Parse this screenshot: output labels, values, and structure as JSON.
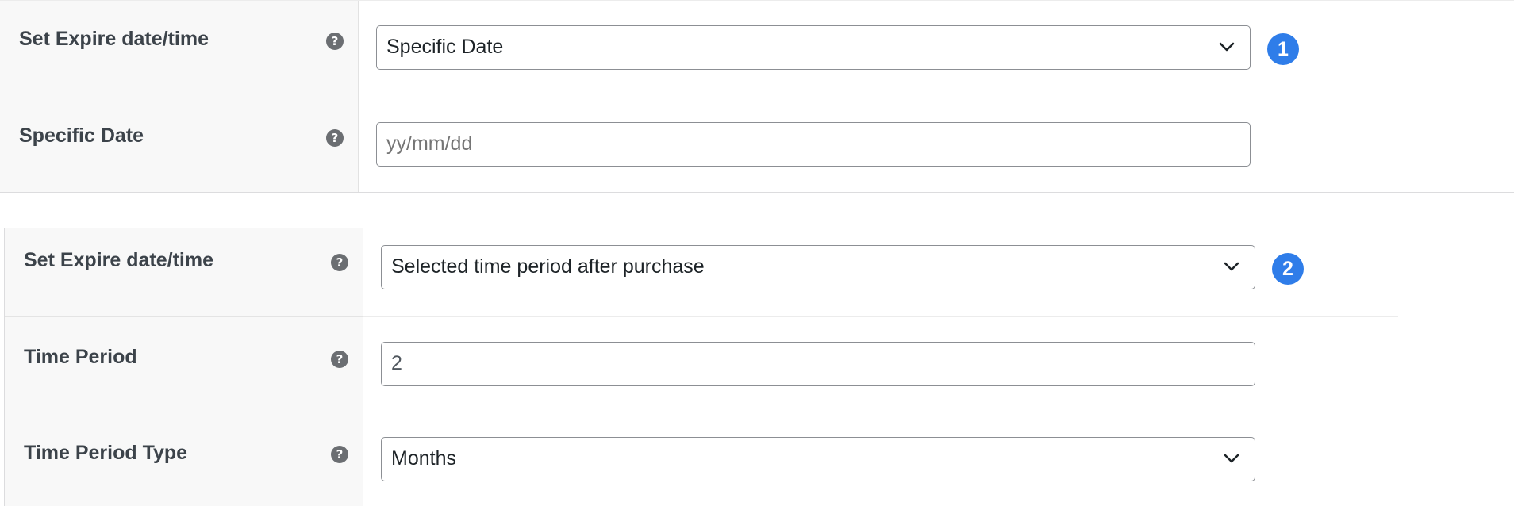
{
  "panel1": {
    "rows": [
      {
        "label": "Set Expire date/time",
        "help_icon": "?",
        "field_type": "select",
        "value": "Specific Date",
        "badge": "1"
      },
      {
        "label": "Specific Date",
        "help_icon": "?",
        "field_type": "text",
        "placeholder": "yy/mm/dd",
        "value": ""
      }
    ]
  },
  "panel2": {
    "rows": [
      {
        "label": "Set Expire date/time",
        "help_icon": "?",
        "field_type": "select",
        "value": "Selected time period after purchase",
        "badge": "2"
      },
      {
        "label": "Time Period",
        "help_icon": "?",
        "field_type": "number",
        "value": "2"
      },
      {
        "label": "Time Period Type",
        "help_icon": "?",
        "field_type": "select",
        "value": "Months"
      }
    ]
  },
  "colors": {
    "badge": "#2f7de9",
    "help_icon": "#6b6e72",
    "label_background": "#f8f8f8",
    "field_border": "#8c8f94"
  },
  "icons": {
    "help": "question-circle-icon",
    "dropdown": "chevron-down-icon"
  }
}
